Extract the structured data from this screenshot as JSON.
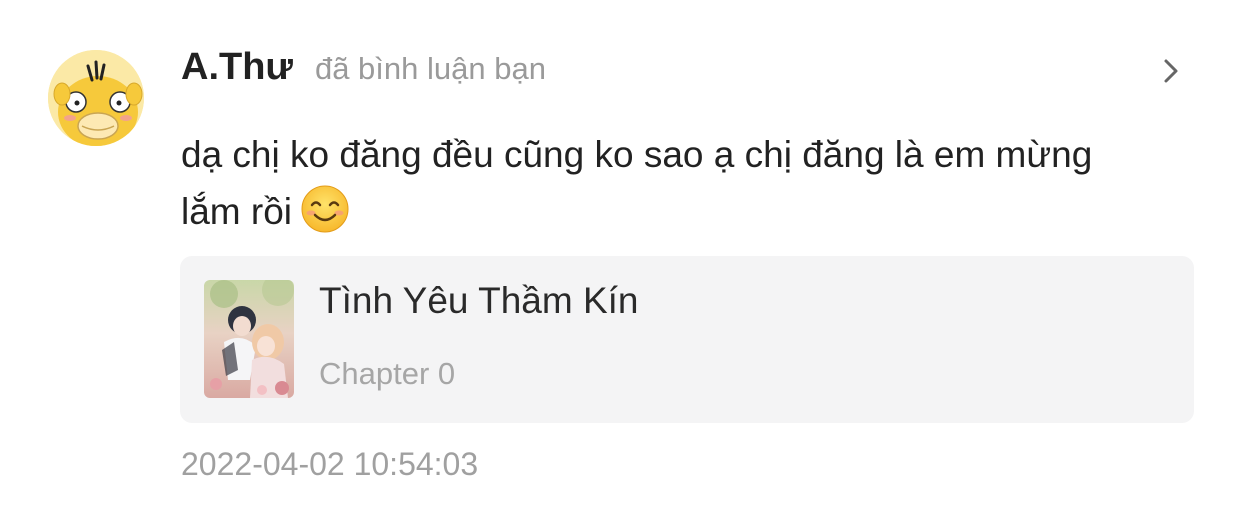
{
  "notification": {
    "username": "A.Thư",
    "action": "đã bình luận bạn",
    "comment_text": "dạ chị ko đăng đều cũng ko sao ạ chị đăng là em mừng lắm rồi",
    "emoji_icon": "smiling-face-icon",
    "manga": {
      "title": "Tình Yêu Thầm Kín",
      "chapter": "Chapter 0"
    },
    "timestamp": "2022-04-02 10:54:03"
  },
  "colors": {
    "username": "#222222",
    "secondary_text": "#9a9a9a",
    "card_background": "#f4f4f5",
    "avatar_yellow": "#f6c93b"
  }
}
